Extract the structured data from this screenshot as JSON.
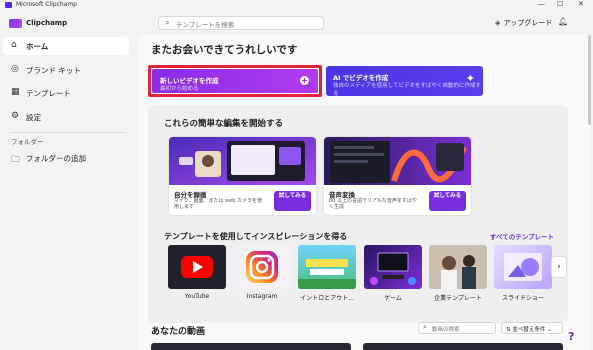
{
  "window": {
    "title": "Microsoft Clipchamp",
    "controls": [
      "—",
      "☐",
      "✕"
    ]
  },
  "header": {
    "brand": "Clipchamp",
    "search_placeholder": "テンプレートを検索",
    "upgrade_label": "アップグレード"
  },
  "sidebar": {
    "items": [
      {
        "label": "ホーム",
        "icon": "home-icon",
        "glyph": "⌂",
        "active": true
      },
      {
        "label": "ブランド キット",
        "icon": "brand-kit-icon",
        "glyph": "◎",
        "active": false
      },
      {
        "label": "テンプレート",
        "icon": "template-icon",
        "glyph": "▦",
        "active": false
      },
      {
        "label": "設定",
        "icon": "gear-icon",
        "glyph": "⚙",
        "active": false
      }
    ],
    "folder_heading": "フォルダー",
    "add_folder_label": "フォルダーの追加"
  },
  "main": {
    "greeting": "またお会いできてうれしいです",
    "new_video": {
      "title": "新しいビデオを作成",
      "subtitle": "最初から始める"
    },
    "ai_video": {
      "title": "AI でビデオを作成",
      "subtitle": "独自のメディアを使用してビデオをすばやく自動的に作成する"
    },
    "edits_heading": "これらの簡単な編集を開始する",
    "edit_cards": [
      {
        "title": "自分を録画",
        "desc": "マイク、画面、または web カメラを使用します",
        "button": "試してみる"
      },
      {
        "title": "音声変換",
        "desc": "80 以上の言語でリアルな音声をすばやく生成",
        "button": "試してみる"
      }
    ],
    "templates_heading": "テンプレートを使用してインスピレーションを得る",
    "all_templates_link": "すべてのテンプレート",
    "templates": [
      {
        "label": "YouTube"
      },
      {
        "label": "Instagram"
      },
      {
        "label": "イントロとアウト..."
      },
      {
        "label": "ゲーム"
      },
      {
        "label": "企業テンプレート"
      },
      {
        "label": "スライドショー"
      }
    ],
    "videos_heading": "あなたの動画",
    "video_search_placeholder": "動画の検索",
    "sort_label": "並べ替え条件"
  },
  "colors": {
    "accent": "#7a2ee0",
    "cta_highlight": "#e0243a",
    "ai_blue": "#4b34e6"
  }
}
